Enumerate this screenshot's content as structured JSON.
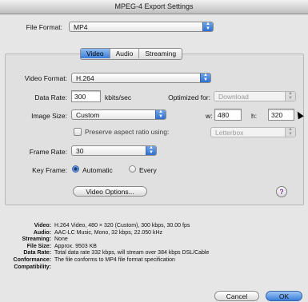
{
  "window": {
    "title": "MPEG-4 Export Settings"
  },
  "file_format": {
    "label": "File Format:",
    "value": "MP4"
  },
  "tabs": [
    {
      "label": "Video",
      "selected": true
    },
    {
      "label": "Audio",
      "selected": false
    },
    {
      "label": "Streaming",
      "selected": false
    }
  ],
  "video": {
    "format": {
      "label": "Video Format:",
      "value": "H.264"
    },
    "data_rate": {
      "label": "Data Rate:",
      "value": "300",
      "unit": "kbits/sec"
    },
    "optimized_for": {
      "label": "Optimized for:",
      "value": "Download"
    },
    "image_size": {
      "label": "Image Size:",
      "value": "Custom"
    },
    "width": {
      "label": "w:",
      "value": "480"
    },
    "height": {
      "label": "h:",
      "value": "320"
    },
    "preserve_aspect": {
      "label": "Preserve aspect ratio using:",
      "value": "Letterbox",
      "checked": false
    },
    "frame_rate": {
      "label": "Frame Rate:",
      "value": "30"
    },
    "key_frame": {
      "label": "Key Frame:",
      "automatic": "Automatic",
      "every": "Every",
      "selected": "Automatic"
    },
    "options_button": "Video Options...",
    "help": "?"
  },
  "summary": [
    {
      "key": "Video:",
      "value": "H.264 Video, 480 × 320 (Custom), 300 kbps, 30.00 fps"
    },
    {
      "key": "Audio:",
      "value": "AAC-LC Music, Mono, 32 kbps, 22.050 kHz"
    },
    {
      "key": "Streaming:",
      "value": "None"
    },
    {
      "key": "File Size:",
      "value": "Approx. 9503 KB"
    },
    {
      "key": "Data Rate:",
      "value": "Total data rate 332 kbps, will stream over 384 kbps DSL/Cable"
    },
    {
      "key": "Conformance:",
      "value": "The file conforms to MP4 file format specification"
    },
    {
      "key": "Compatibility:",
      "value": ""
    }
  ],
  "buttons": {
    "cancel": "Cancel",
    "ok": "OK"
  }
}
